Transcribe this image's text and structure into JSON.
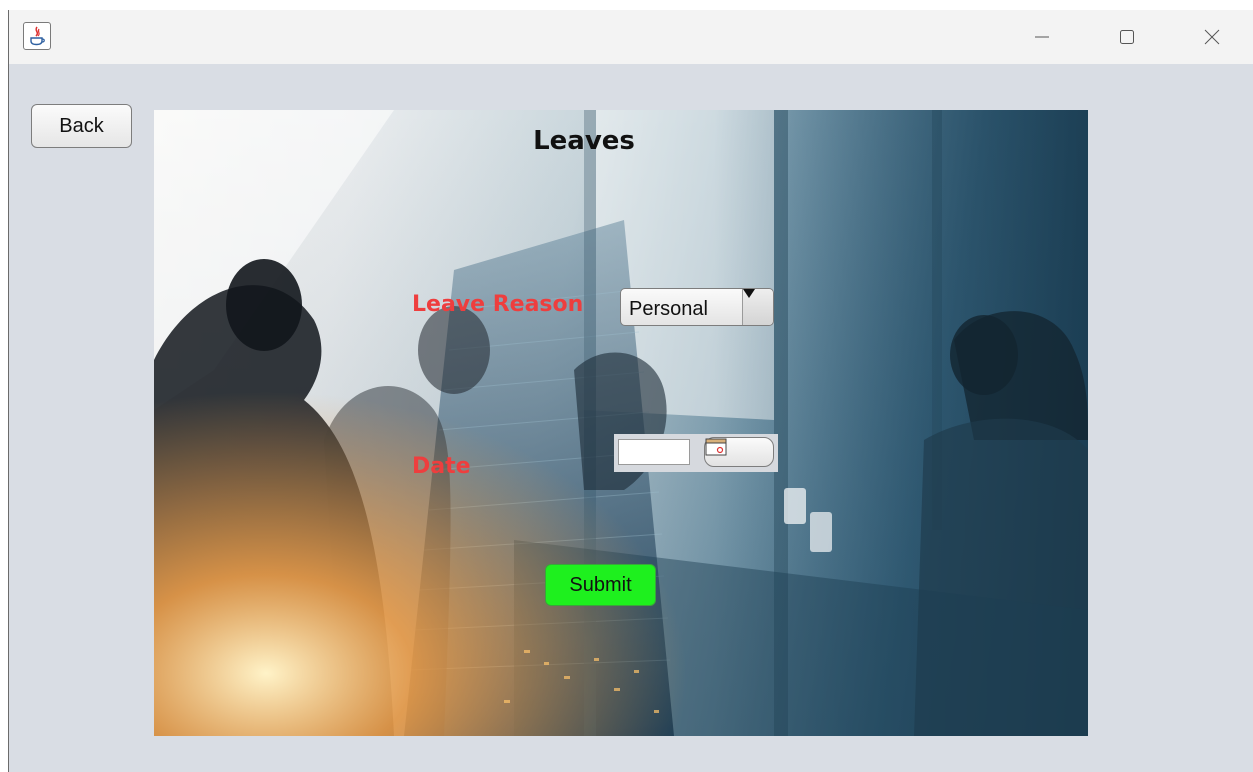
{
  "window": {
    "title": "",
    "controls": {
      "minimize_icon": "minimize-icon",
      "maximize_icon": "maximize-icon",
      "close_icon": "close-icon"
    }
  },
  "toolbar": {
    "back_label": "Back"
  },
  "form": {
    "title": "Leaves",
    "leave_reason_label": "Leave Reason",
    "leave_reason_value": "Personal",
    "date_label": "Date",
    "date_value": "",
    "calendar_icon": "calendar-icon",
    "submit_label": "Submit"
  },
  "colors": {
    "label_red": "#ee3e3e",
    "submit_green": "#1ef01e",
    "window_bg": "#d9dde4"
  }
}
